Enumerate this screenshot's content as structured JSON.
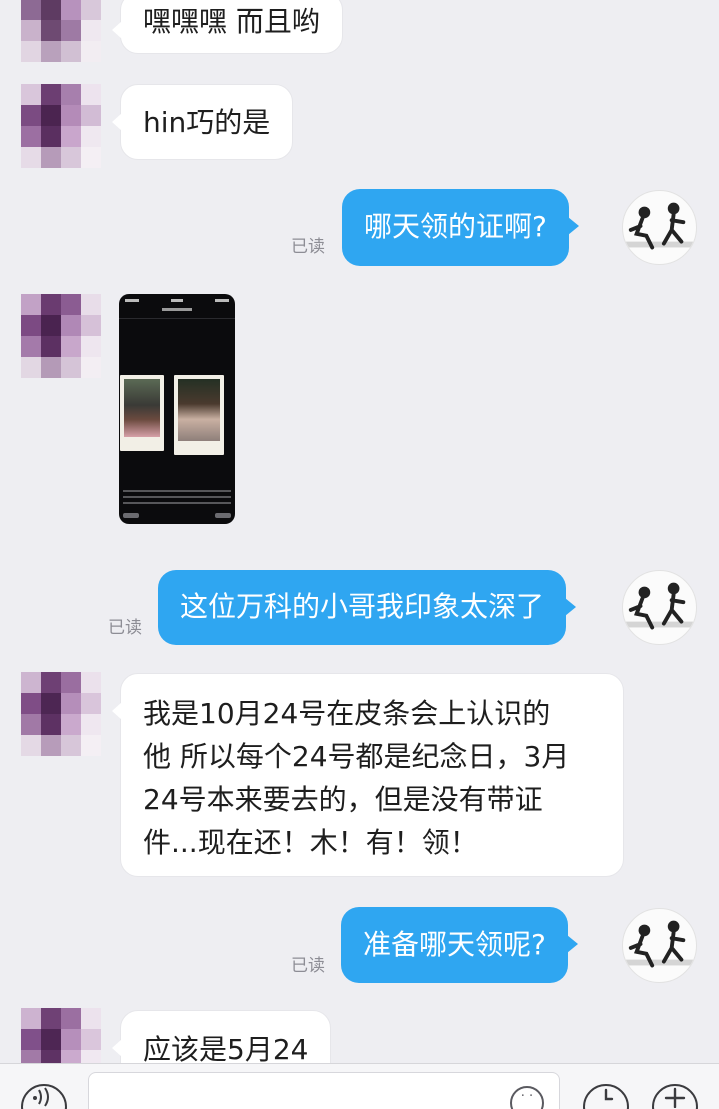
{
  "messages": {
    "m1": {
      "text": "嘿嘿嘿 而且哟"
    },
    "m2": {
      "text": "hin巧的是"
    },
    "m3": {
      "text": "哪天领的证啊?",
      "status": "已读"
    },
    "m5": {
      "text": "这位万科的小哥我印象太深了",
      "status": "已读"
    },
    "m6": {
      "lines": [
        "我是10月24号在皮条会上认识的",
        "他 所以每个24号都是纪念日，3月",
        "24号本来要去的，但是没有带证",
        "件...现在还！木！有！领！"
      ]
    },
    "m7": {
      "text": "准备哪天领呢?",
      "status": "已读"
    },
    "m8": {
      "text": "应该是5月24"
    }
  },
  "image_message": {
    "kind": "screenshot-with-two-photos"
  },
  "input_bar": {
    "placeholder": "",
    "voice_icon": "voice-wave-icon",
    "emoji_icon": "emoji-face-icon",
    "clock_icon": "clock-icon",
    "plus_icon": "plus-icon"
  },
  "colors": {
    "background": "#eeeef2",
    "sent_bubble": "#2fa6f1",
    "received_bubble": "#ffffff",
    "read_status": "#8d8d95"
  }
}
